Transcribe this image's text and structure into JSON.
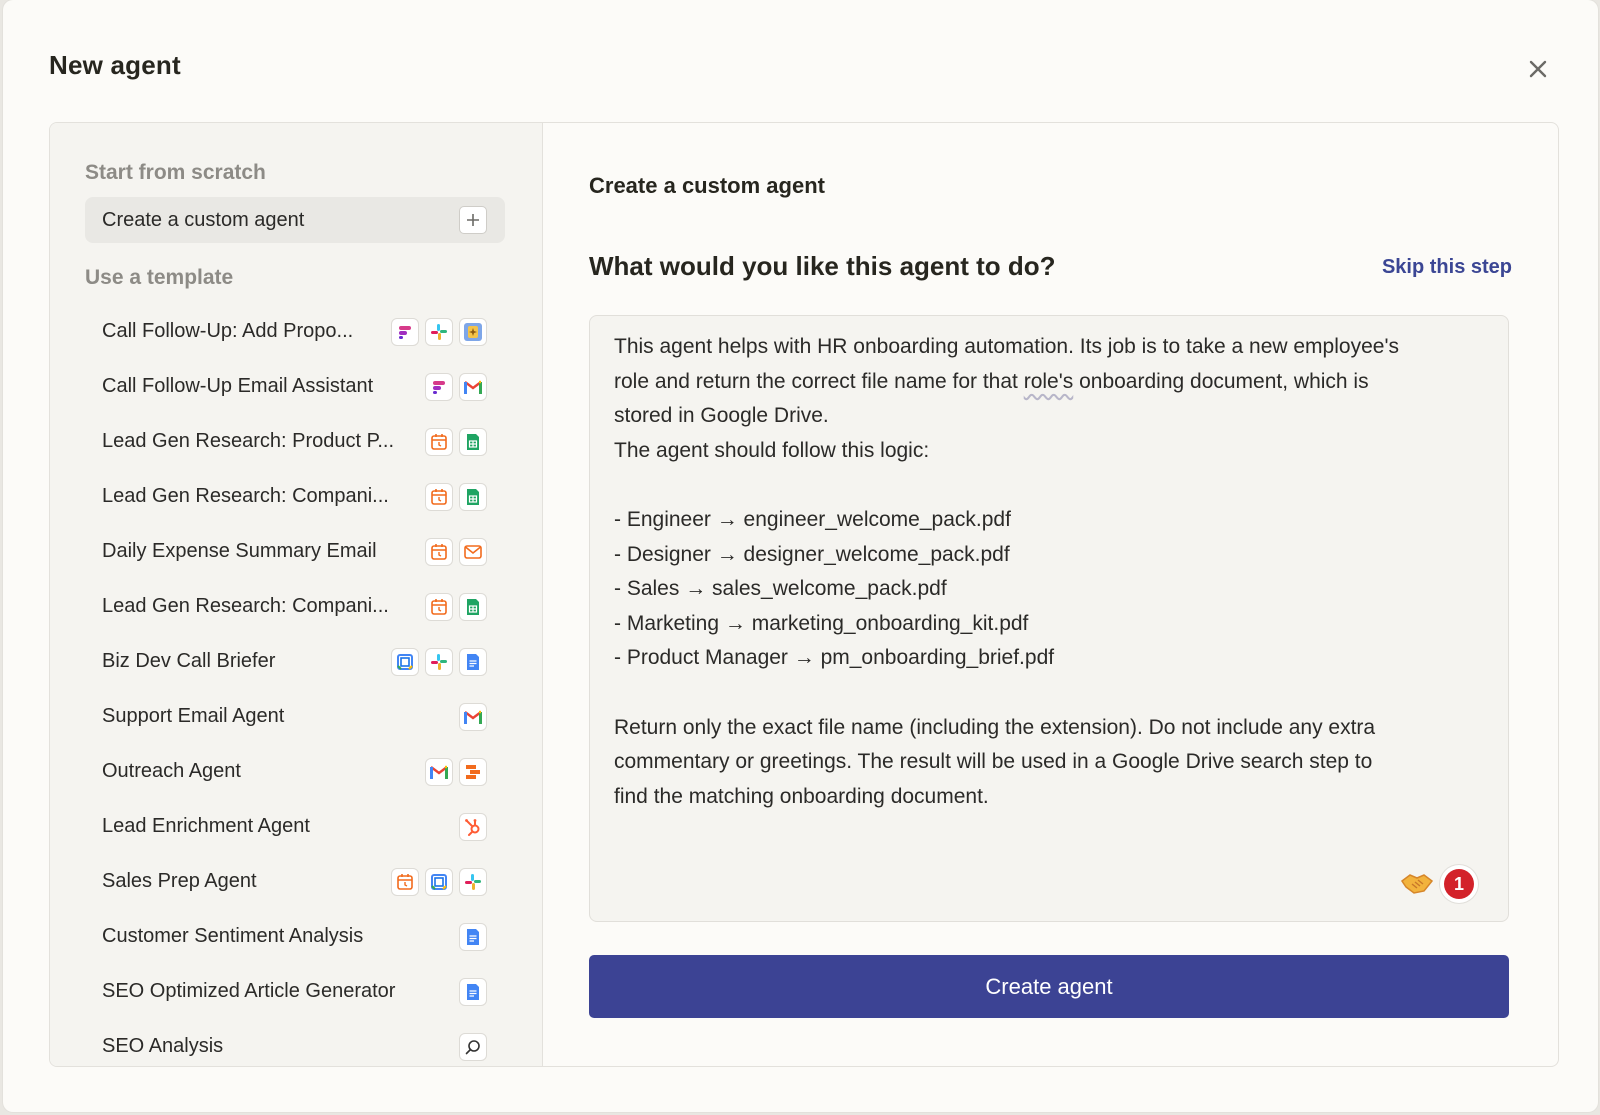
{
  "modal": {
    "title": "New agent",
    "close_icon": "close-icon"
  },
  "left": {
    "scratch_label": "Start from scratch",
    "custom_agent_label": "Create a custom agent",
    "template_label": "Use a template",
    "templates": [
      {
        "name": "Call Follow-Up: Add Propo...",
        "icons": [
          "fathom",
          "slack",
          "ai-sparkle"
        ]
      },
      {
        "name": "Call Follow-Up Email Assistant",
        "icons": [
          "fathom",
          "gmail"
        ]
      },
      {
        "name": "Lead Gen Research: Product P...",
        "icons": [
          "schedule",
          "sheets"
        ]
      },
      {
        "name": "Lead Gen Research: Compani...",
        "icons": [
          "schedule",
          "sheets"
        ]
      },
      {
        "name": "Daily Expense Summary Email",
        "icons": [
          "schedule",
          "email"
        ]
      },
      {
        "name": "Lead Gen Research: Compani...",
        "icons": [
          "schedule",
          "sheets"
        ]
      },
      {
        "name": "Biz Dev Call Briefer",
        "icons": [
          "calendar",
          "slack",
          "docs"
        ]
      },
      {
        "name": "Support Email Agent",
        "icons": [
          "gmail"
        ]
      },
      {
        "name": "Outreach Agent",
        "icons": [
          "gmail",
          "formatter"
        ]
      },
      {
        "name": "Lead Enrichment Agent",
        "icons": [
          "hubspot"
        ]
      },
      {
        "name": "Sales Prep Agent",
        "icons": [
          "schedule",
          "calendar",
          "slack"
        ]
      },
      {
        "name": "Customer Sentiment Analysis",
        "icons": [
          "docs"
        ]
      },
      {
        "name": "SEO Optimized Article Generator",
        "icons": [
          "docs"
        ]
      },
      {
        "name": "SEO Analysis",
        "icons": [
          "search"
        ]
      }
    ]
  },
  "right": {
    "heading": "Create a custom agent",
    "question": "What would you like this agent to do?",
    "skip_label": "Skip this step",
    "prompt": {
      "l1": "This agent helps with HR onboarding automation. Its job is to take a new employee's",
      "l2a": "role and return the correct file name for that ",
      "l2b": "role's",
      "l2c": " onboarding document, which is",
      "l3": "stored in Google Drive.",
      "l4": "The agent should follow this logic:",
      "l5": "",
      "l6": "- Engineer → engineer_welcome_pack.pdf",
      "l7": "- Designer → designer_welcome_pack.pdf",
      "l8": "- Sales → sales_welcome_pack.pdf",
      "l9": "- Marketing → marketing_onboarding_kit.pdf",
      "l10": "- Product Manager → pm_onboarding_brief.pdf",
      "l11": "",
      "l12": "Return only the exact file name (including the extension). Do not include any extra",
      "l13": "commentary or greetings. The result will be used in a Google Drive search step to",
      "l14": "find the matching onboarding document."
    },
    "notification_count": "1",
    "create_button_label": "Create agent"
  },
  "colors": {
    "accent": "#3c4394",
    "link": "#3b4694",
    "badge": "#d3222a"
  }
}
